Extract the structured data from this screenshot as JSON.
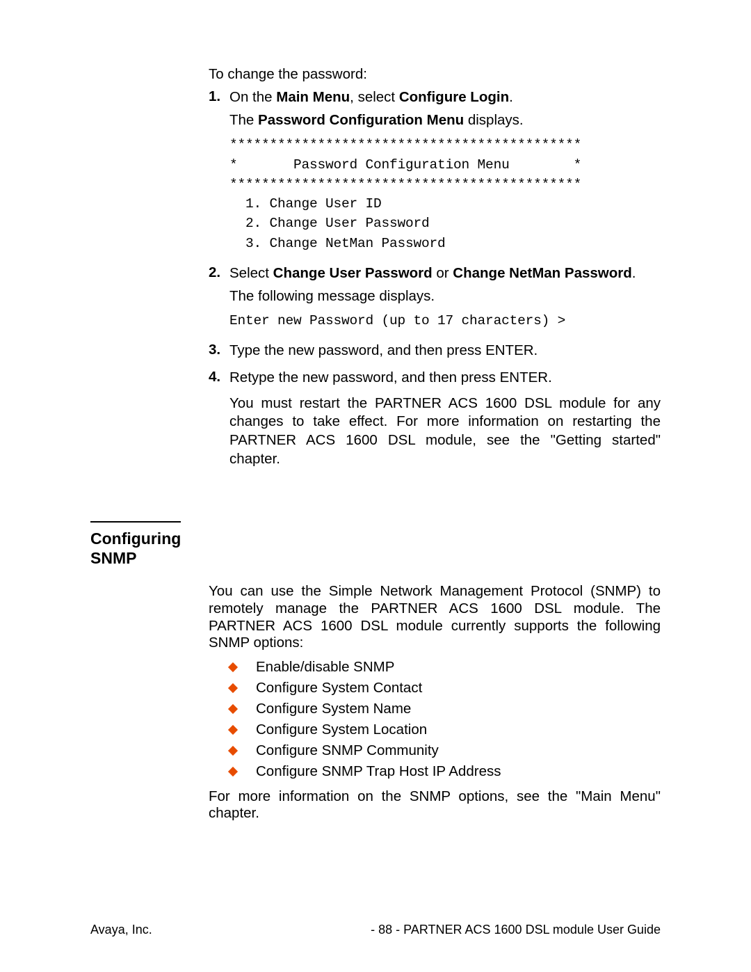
{
  "intro": "To change the password:",
  "steps": [
    {
      "num": "1.",
      "parts": [
        {
          "text": "On the ",
          "bold": false
        },
        {
          "text": "Main Menu",
          "bold": true
        },
        {
          "text": ", select ",
          "bold": false
        },
        {
          "text": "Configure Login",
          "bold": true
        },
        {
          "text": ".",
          "bold": false
        }
      ],
      "followup": [
        {
          "text": "The ",
          "bold": false
        },
        {
          "text": "Password Configuration Menu",
          "bold": true
        },
        {
          "text": " displays.",
          "bold": false
        }
      ],
      "terminal": "********************************************\n*       Password Configuration Menu        *\n********************************************\n  1. Change User ID\n  2. Change User Password\n  3. Change NetMan Password"
    },
    {
      "num": "2.",
      "justify": true,
      "parts": [
        {
          "text": "Select ",
          "bold": false
        },
        {
          "text": "Change User Password",
          "bold": true
        },
        {
          "text": " or ",
          "bold": false
        },
        {
          "text": "Change NetMan Password",
          "bold": true
        },
        {
          "text": ".",
          "bold": false
        }
      ],
      "followup_plain": "The following message displays.",
      "terminal": "Enter new Password (up to 17 characters) >"
    },
    {
      "num": "3.",
      "plain": "Type the new password, and then press ENTER."
    },
    {
      "num": "4.",
      "plain": "Retype the new password, and then press ENTER.",
      "followup_plain_justify": "You must restart the PARTNER ACS 1600 DSL module for any changes to take effect.  For more information on restarting the PARTNER ACS 1600 DSL module, see the \"Getting started\" chapter."
    }
  ],
  "section": {
    "title": "Configuring SNMP",
    "para1": "You can use the Simple Network Management Protocol (SNMP) to remotely manage the PARTNER ACS 1600 DSL module.  The PARTNER ACS 1600 DSL module currently supports the following SNMP options:",
    "bullets": [
      "Enable/disable SNMP",
      "Configure System Contact",
      "Configure System Name",
      "Configure System Location",
      "Configure SNMP Community",
      "Configure SNMP Trap Host IP Address"
    ],
    "para2": "For more information on the SNMP options, see the \"Main Menu\" chapter."
  },
  "footer": {
    "left": "Avaya, Inc.",
    "right": "- 88 -  PARTNER ACS 1600 DSL module User Guide"
  }
}
